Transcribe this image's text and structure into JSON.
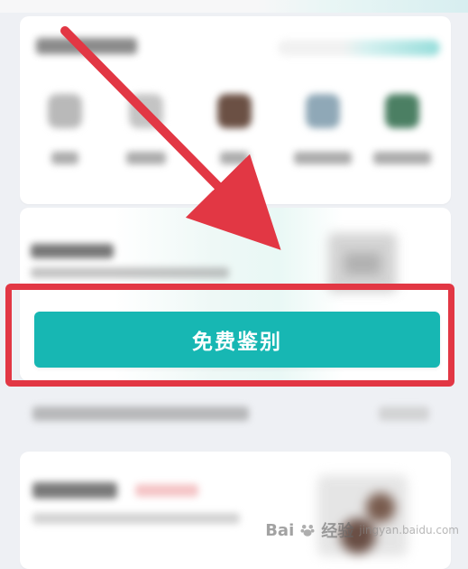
{
  "colors": {
    "accent": "#17b7b3",
    "highlight": "#e23744",
    "page_bg": "#eef0f4"
  },
  "primary_action": {
    "label": "免费鉴别"
  },
  "watermark": {
    "brand_prefix": "Bai",
    "brand_suffix": "经验",
    "url": "jingyan.baidu.com",
    "icon": "paw-icon"
  }
}
